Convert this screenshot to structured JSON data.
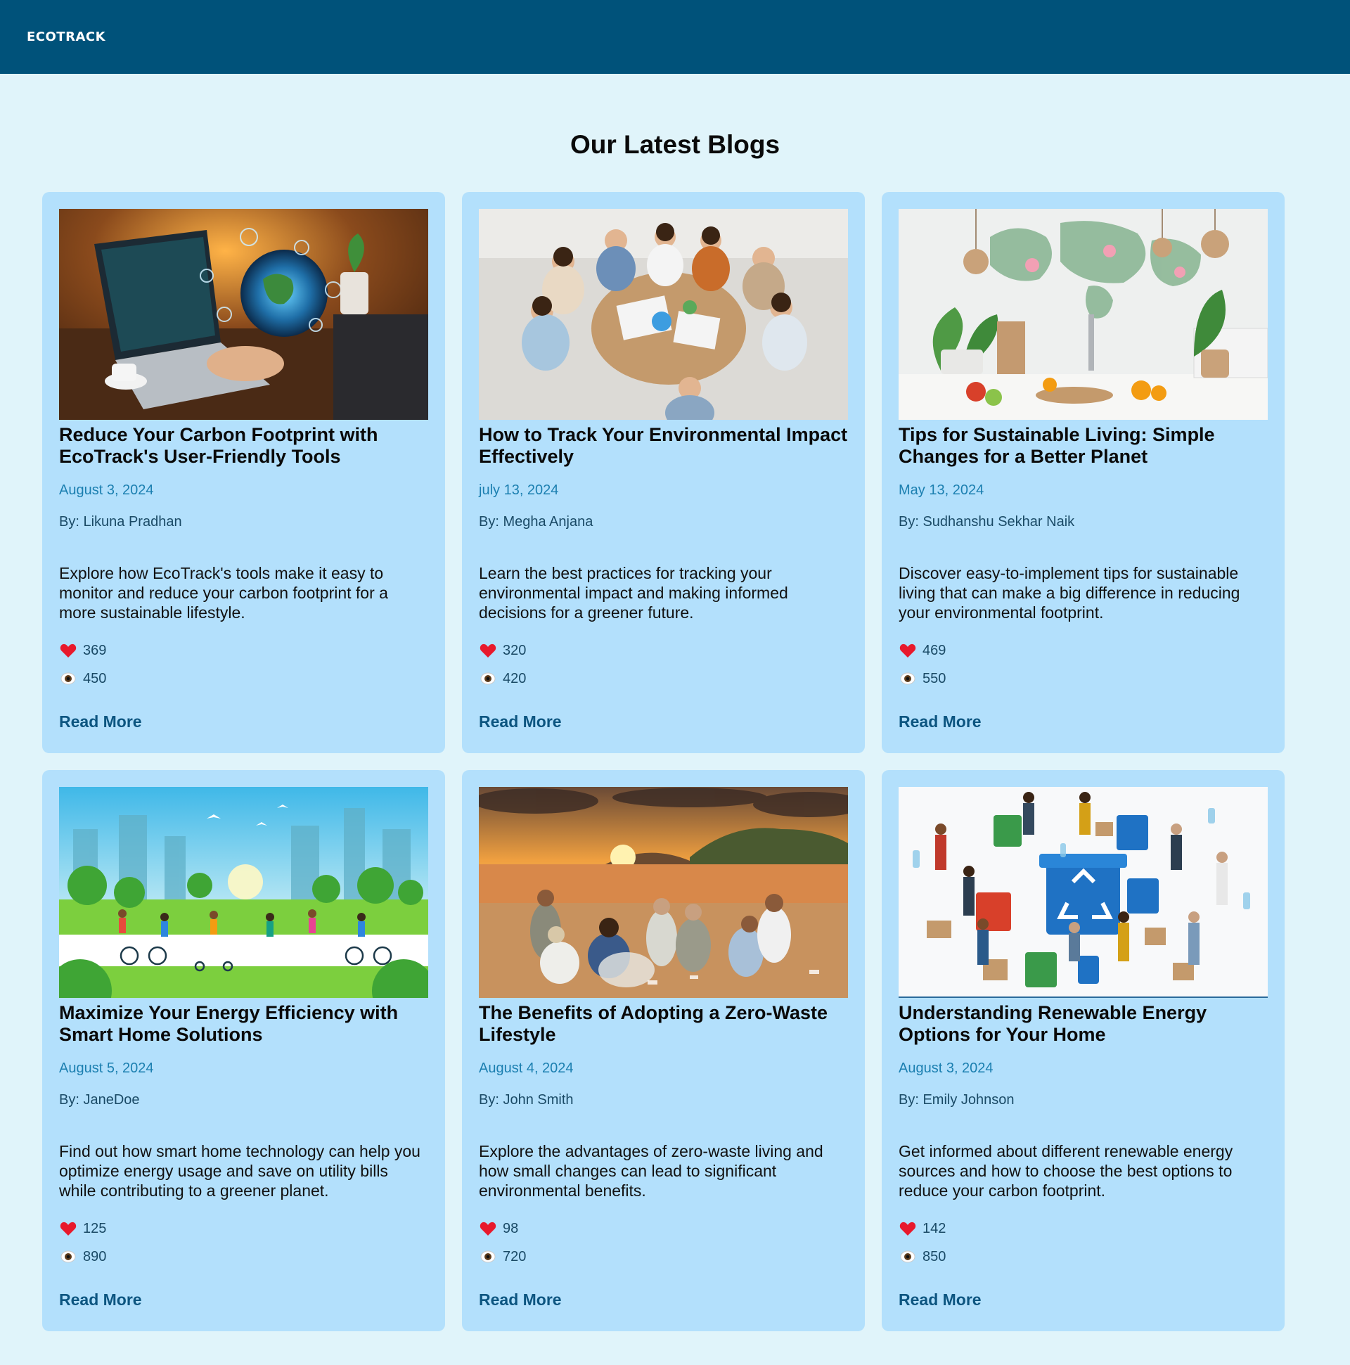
{
  "header": {
    "logo": "ECOTRACK"
  },
  "main": {
    "title": "Our Latest Blogs"
  },
  "colors": {
    "nav": "#00527a",
    "background": "#e0f4fa",
    "card": "#b3e0fc",
    "date": "#1b7fb0",
    "link": "#0c5580"
  },
  "blogs": [
    {
      "title": "Reduce Your Carbon Footprint with EcoTrack's User-Friendly Tools",
      "date": "August 3, 2024",
      "author": "By: Likuna Pradhan",
      "description": "Explore how EcoTrack's tools make it easy to monitor and reduce your carbon footprint for a more sustainable lifestyle.",
      "likes": "369",
      "views": "450",
      "cta": "Read More",
      "image": "laptop-globe-tech-illustration"
    },
    {
      "title": "How to Track Your Environmental Impact Effectively",
      "date": "july 13, 2024",
      "author": "By: Megha Anjana",
      "description": "Learn the best practices for tracking your environmental impact and making informed decisions for a greener future.",
      "likes": "320",
      "views": "420",
      "cta": "Read More",
      "image": "group-meeting-round-table-photo"
    },
    {
      "title": "Tips for Sustainable Living: Simple Changes for a Better Planet",
      "date": "May 13, 2024",
      "author": "By: Sudhanshu Sekhar Naik",
      "description": "Discover easy-to-implement tips for sustainable living that can make a big difference in reducing your environmental footprint.",
      "likes": "469",
      "views": "550",
      "cta": "Read More",
      "image": "kitchen-plants-world-map-photo"
    },
    {
      "title": "Maximize Your Energy Efficiency with Smart Home Solutions",
      "date": "August 5, 2024",
      "author": "By: JaneDoe",
      "description": "Find out how smart home technology can help you optimize energy usage and save on utility bills while contributing to a greener planet.",
      "likes": "125",
      "views": "890",
      "cta": "Read More",
      "image": "green-city-park-illustration"
    },
    {
      "title": "The Benefits of Adopting a Zero-Waste Lifestyle",
      "date": "August 4, 2024",
      "author": "By: John Smith",
      "description": "Explore the advantages of zero-waste living and how small changes can lead to significant environmental benefits.",
      "likes": "98",
      "views": "720",
      "cta": "Read More",
      "image": "beach-cleanup-sunset-photo"
    },
    {
      "title": "Understanding Renewable Energy Options for Your Home",
      "date": "August 3, 2024",
      "author": "By: Emily Johnson",
      "description": "Get informed about different renewable energy sources and how to choose the best options to reduce your carbon footprint.",
      "likes": "142",
      "views": "850",
      "cta": "Read More",
      "image": "recycling-bins-people-illustration"
    }
  ]
}
